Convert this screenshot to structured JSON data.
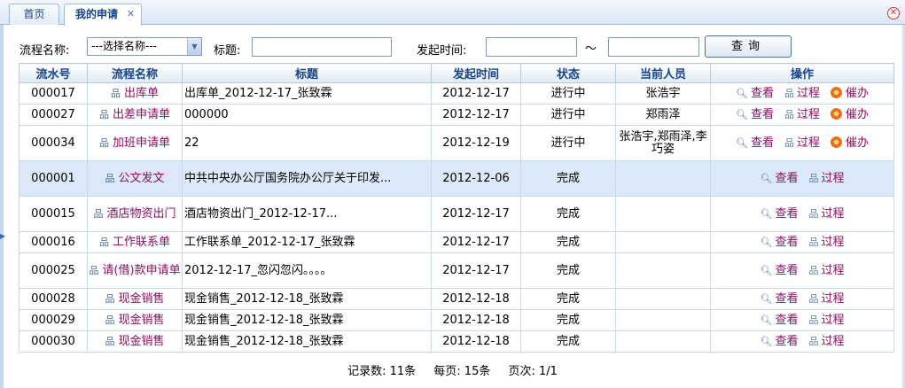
{
  "tabs": {
    "home": "首页",
    "active": "我的申请"
  },
  "filter": {
    "workflow_label": "流程名称:",
    "workflow_selected": "---选择名称---",
    "title_label": "标题:",
    "title_value": "",
    "time_label": "发起时间:",
    "time_from": "",
    "tilde": "～",
    "time_to": "",
    "query_button": "查询"
  },
  "table": {
    "headers": [
      "流水号",
      "流程名称",
      "标题",
      "发起时间",
      "状态",
      "当前人员",
      "操作"
    ],
    "rows": [
      {
        "id": "000017",
        "workflow": "出库单",
        "title": "出库单_2012-12-17_张致霖",
        "date": "2012-12-17",
        "status": "进行中",
        "person": "张浩宇",
        "actions": [
          "查看",
          "过程",
          "催办"
        ]
      },
      {
        "id": "000027",
        "workflow": "出差申请单",
        "title": "000000",
        "date": "2012-12-17",
        "status": "进行中",
        "person": "郑雨泽",
        "actions": [
          "查看",
          "过程",
          "催办"
        ]
      },
      {
        "id": "000034",
        "workflow": "加班申请单",
        "title": "22",
        "date": "2012-12-19",
        "status": "进行中",
        "person": "张浩宇,郑雨泽,李巧姿",
        "actions": [
          "查看",
          "过程",
          "催办"
        ]
      },
      {
        "id": "000001",
        "workflow": "公文发文",
        "title": "中共中央办公厅国务院办公厅关于印发...",
        "date": "2012-12-06",
        "status": "完成",
        "person": "",
        "actions": [
          "查看",
          "过程"
        ]
      },
      {
        "id": "000015",
        "workflow": "酒店物资出门",
        "title": "酒店物资出门_2012-12-17...",
        "date": "2012-12-17",
        "status": "完成",
        "person": "",
        "actions": [
          "查看",
          "过程"
        ]
      },
      {
        "id": "000016",
        "workflow": "工作联系单",
        "title": "工作联系单_2012-12-17_张致霖",
        "date": "2012-12-17",
        "status": "完成",
        "person": "",
        "actions": [
          "查看",
          "过程"
        ]
      },
      {
        "id": "000025",
        "workflow": "请(借)款申请单",
        "title": "2012-12-17_忽闪忽闪。。。。",
        "date": "2012-12-17",
        "status": "完成",
        "person": "",
        "actions": [
          "查看",
          "过程"
        ]
      },
      {
        "id": "000028",
        "workflow": "现金销售",
        "title": "现金销售_2012-12-18_张致霖",
        "date": "2012-12-18",
        "status": "完成",
        "person": "",
        "actions": [
          "查看",
          "过程"
        ]
      },
      {
        "id": "000029",
        "workflow": "现金销售",
        "title": "现金销售_2012-12-18_张致霖",
        "date": "2012-12-18",
        "status": "完成",
        "person": "",
        "actions": [
          "查看",
          "过程"
        ]
      },
      {
        "id": "000030",
        "workflow": "现金销售",
        "title": "现金销售_2012-12-18_张致霖",
        "date": "2012-12-18",
        "status": "完成",
        "person": "",
        "actions": [
          "查看",
          "过程"
        ]
      }
    ]
  },
  "pager": {
    "records": "记录数:  11条",
    "per_page": "每页:  15条",
    "page": "页次:  1/1"
  }
}
